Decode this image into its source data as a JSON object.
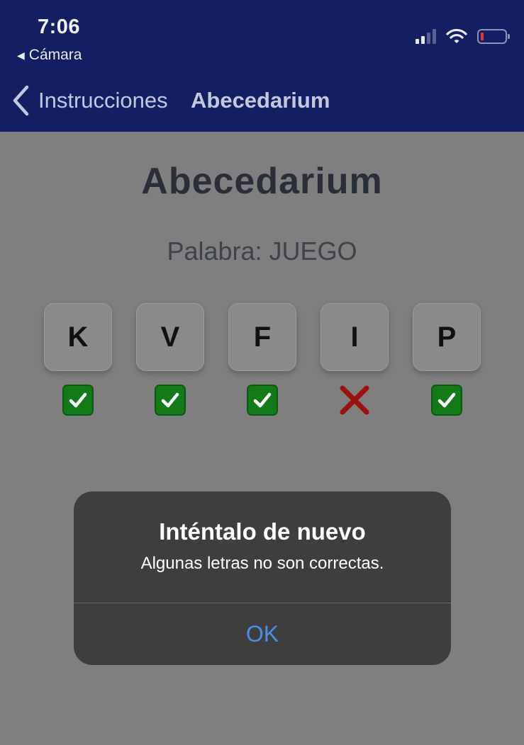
{
  "status_bar": {
    "time": "7:06",
    "back_app": "Cámara",
    "back_icon": "triangle-left-icon",
    "battery_color": "#e53935"
  },
  "nav": {
    "back_label": "Instrucciones",
    "title": "Abecedarium",
    "bar_color": "#131e63"
  },
  "main": {
    "title": "Abecedarium",
    "word_label": "Palabra: JUEGO",
    "tiles": [
      {
        "letter": "K",
        "result": "correct"
      },
      {
        "letter": "V",
        "result": "correct"
      },
      {
        "letter": "F",
        "result": "correct"
      },
      {
        "letter": "I",
        "result": "incorrect"
      },
      {
        "letter": "P",
        "result": "correct"
      }
    ],
    "icons": {
      "correct": "check-mark-button-icon",
      "incorrect": "cross-mark-icon"
    }
  },
  "alert": {
    "title": "Inténtalo de nuevo",
    "message": "Algunas letras no son correctas.",
    "ok_label": "OK",
    "ok_color": "#4a90e2"
  }
}
